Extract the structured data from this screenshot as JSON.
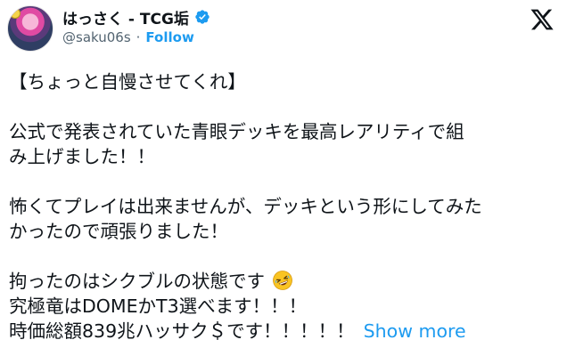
{
  "author": {
    "display_name": "はっさく - TCG垢",
    "handle": "@saku06s",
    "separator": "·",
    "follow_label": "Follow",
    "verified": true,
    "verified_icon": "verified-badge-icon",
    "brand_icon": "x-logo-icon"
  },
  "tweet": {
    "lines": [
      "【ちょっと自慢させてくれ】",
      "",
      "公式で発表されていた青眼デッキを最高レアリティで組",
      "み上げました！！",
      "",
      "怖くてプレイは出来ませんが、デッキという形にしてみた",
      "かったので頑張りました！",
      "",
      "拘ったのはシクブルの状態です",
      "究極竜はDOMEかT3選べます！！！",
      "時価総額839兆ハッサク＄です！！！！！"
    ],
    "emoji": "rolling-on-floor-laughing-emoji",
    "show_more_label": "Show more"
  },
  "colors": {
    "text": "#0f1419",
    "secondary": "#536471",
    "accent": "#1d9bf0"
  }
}
